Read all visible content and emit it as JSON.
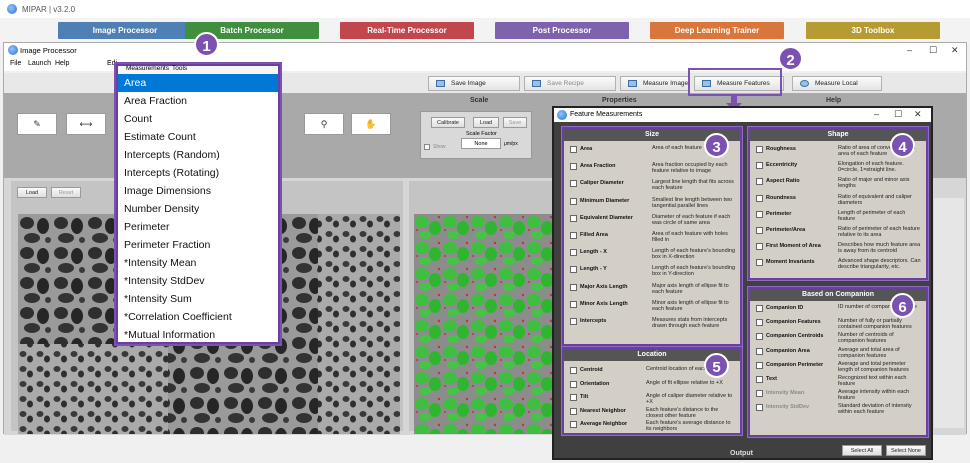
{
  "app": {
    "title": "MIPAR  |  v3.2.0"
  },
  "modules": [
    {
      "label": "Image Processor",
      "color": "#4e7fb5"
    },
    {
      "label": "Batch Processor",
      "color": "#3f8f3f"
    },
    {
      "label": "Real-Time Processor",
      "color": "#c2474d"
    },
    {
      "label": "Post Processor",
      "color": "#7e62ae"
    },
    {
      "label": "Deep Learning Trainer",
      "color": "#d9763c"
    },
    {
      "label": "3D Toolbox",
      "color": "#b59b31"
    }
  ],
  "ip_window": {
    "title": "Image Processor",
    "menu": [
      "File",
      "Launch",
      "Help",
      "Edi",
      "Measurements",
      "Tools"
    ],
    "toolbar": [
      "Save Image",
      "Save Recipe",
      "Measure Image",
      "Measure Features",
      "Measure Local"
    ],
    "sections": {
      "scale": "Scale",
      "properties": "Properties",
      "help": "Help"
    },
    "scale": {
      "calibrate": "Calibrate",
      "load": "Load",
      "save": "Save",
      "factor_label": "Scale Factor",
      "factor_value": "None",
      "unit": "μm/px",
      "show": "Show"
    },
    "panel_buttons": {
      "load": "Load",
      "reset": "Reset"
    },
    "output_label": "Output"
  },
  "measurements_menu": {
    "items": [
      "Area",
      "Area Fraction",
      "Count",
      "Estimate Count",
      "Intercepts (Random)",
      "Intercepts (Rotating)",
      "Image Dimensions",
      "Number Density",
      "Perimeter",
      "Perimeter Fraction",
      "*Intensity Mean",
      "*Intensity StdDev",
      "*Intensity Sum",
      "*Correlation Coefficient",
      "*Mutual Information"
    ],
    "selected": "Area"
  },
  "feature_dialog": {
    "title": "Feature Measurements",
    "size": {
      "header": "Size",
      "rows": [
        {
          "name": "Area",
          "desc": "Area of each feature"
        },
        {
          "name": "Area Fraction",
          "desc": "Area fraction occupied by each feature relative to image"
        },
        {
          "name": "Caliper Diameter",
          "desc": "Largest line length that fits across each feature"
        },
        {
          "name": "Minimum Diameter",
          "desc": "Smallest line length between two tangential parallel lines"
        },
        {
          "name": "Equivalent Diameter",
          "desc": "Diameter of each feature if each was circle of same area"
        },
        {
          "name": "Filled Area",
          "desc": "Area of each feature with holes filled in"
        },
        {
          "name": "Length - X",
          "desc": "Length of each feature's bounding box in X-direction"
        },
        {
          "name": "Length - Y",
          "desc": "Length of each feature's bounding box in Y-direction"
        },
        {
          "name": "Major Axis Length",
          "desc": "Major axis length of ellipse fit to each feature"
        },
        {
          "name": "Minor Axis Length",
          "desc": "Minor axis length of ellipse fit to each feature"
        },
        {
          "name": "Intercepts",
          "desc": "Measures stats from intercepts drawn through each feature"
        }
      ]
    },
    "shape": {
      "header": "Shape",
      "rows": [
        {
          "name": "Roughness",
          "desc": "Ratio of area of convex hull and area of each feature"
        },
        {
          "name": "Eccentricity",
          "desc": "Elongation of each feature. 0=circle, 1=straight line."
        },
        {
          "name": "Aspect Ratio",
          "desc": "Ratio of major and minor axis lengths"
        },
        {
          "name": "Roundness",
          "desc": "Ratio of equivalent and caliper diameters"
        },
        {
          "name": "Perimeter",
          "desc": "Length of perimeter of each feature"
        },
        {
          "name": "Perimeter/Area",
          "desc": "Ratio of perimeter of each feature relative to its area"
        },
        {
          "name": "First Moment of Area",
          "desc": "Describes how much feature area is away from its centroid"
        },
        {
          "name": "Moment Invariants",
          "desc": "Advanced shape descriptors. Can describe triangularity, etc."
        }
      ]
    },
    "location": {
      "header": "Location",
      "rows": [
        {
          "name": "Centroid",
          "desc": "Centroid location of each feature"
        },
        {
          "name": "Orientation",
          "desc": "Angle of fit ellipse relative to +X"
        },
        {
          "name": "Tilt",
          "desc": "Angle of caliper diameter relative to +X"
        },
        {
          "name": "Nearest Neighbor",
          "desc": "Each feature's distance to the closest other feature"
        },
        {
          "name": "Average Neighbor",
          "desc": "Each feature's average distance to its neighbors"
        }
      ]
    },
    "companion": {
      "header": "Based on Companion",
      "rows": [
        {
          "name": "Companion ID",
          "desc": "ID number of companion feature"
        },
        {
          "name": "Companion Features",
          "desc": "Number of fully or partially contained companion features"
        },
        {
          "name": "Companion Centroids",
          "desc": "Number of centroids of companion features"
        },
        {
          "name": "Companion Area",
          "desc": "Average and total area of companion features"
        },
        {
          "name": "Companion Perimeter",
          "desc": "Average and total perimeter length of companion features"
        },
        {
          "name": "Text",
          "desc": "Recognized text within each feature"
        },
        {
          "name": "Intensity Mean",
          "desc": "Average intensity within each feature"
        },
        {
          "name": "Intensity StdDev",
          "desc": "Standard deviation of intensity within each feature"
        }
      ]
    },
    "select_all": "Select All",
    "select_none": "Select None"
  },
  "badges": [
    "1",
    "2",
    "3",
    "4",
    "5",
    "6"
  ],
  "colors": {
    "accent": "#7b52b0",
    "selection": "#0078d7"
  }
}
